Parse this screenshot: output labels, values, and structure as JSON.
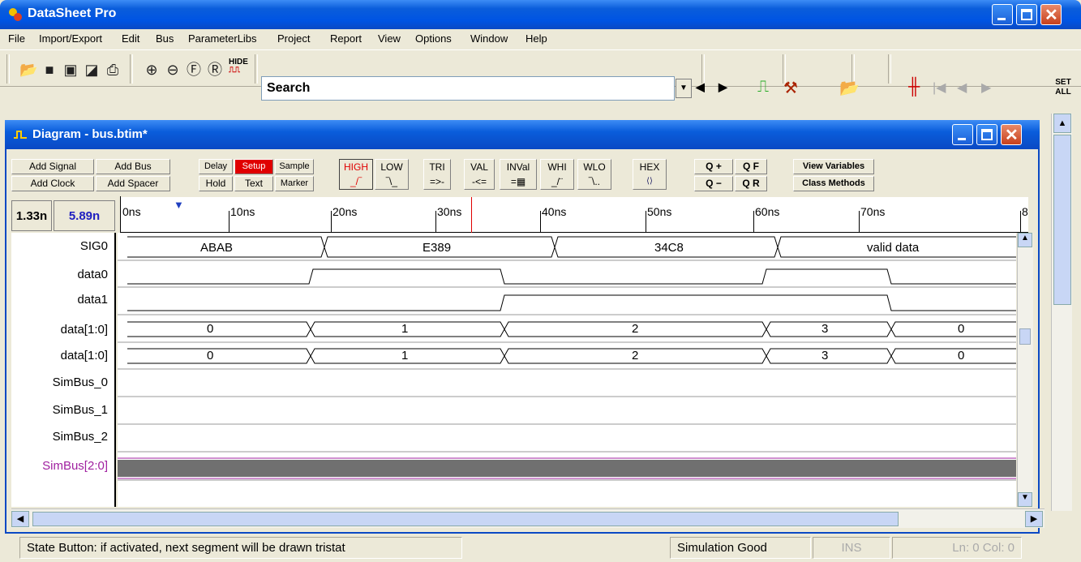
{
  "app": {
    "title": "DataSheet Pro"
  },
  "menu": [
    "File",
    "Import/Export",
    "Edit",
    "Bus",
    "ParameterLibs",
    "Project",
    "Report",
    "View",
    "Options",
    "Window",
    "Help"
  ],
  "toolbar": {
    "search_value": "Search",
    "hide_label": "HIDE",
    "set_all_label": "SET ALL"
  },
  "diagram": {
    "title": "Diagram - bus.btim*",
    "buttons": {
      "add_signal": "Add Signal",
      "add_bus": "Add Bus",
      "add_clock": "Add Clock",
      "add_spacer": "Add Spacer",
      "delay": "Delay",
      "setup": "Setup",
      "sample": "Sample",
      "hold": "Hold",
      "text": "Text",
      "marker": "Marker",
      "high": "HIGH",
      "low": "LOW",
      "tri": "TRI",
      "val": "VAL",
      "inval": "INVal",
      "whi": "WHI",
      "wlo": "WLO",
      "hex": "HEX",
      "zoom_in": "Q +",
      "zoom_fit": "Q F",
      "zoom_out": "Q −",
      "zoom_reset": "Q R",
      "view_variables": "View Variables",
      "class_methods": "Class Methods"
    },
    "time_left": "1.33n",
    "time_right": "5.89n",
    "ruler": [
      "0ns",
      "10ns",
      "20ns",
      "30ns",
      "40ns",
      "50ns",
      "60ns",
      "70ns",
      "8"
    ],
    "signals": [
      {
        "name": "SIG0",
        "segments": [
          "ABAB",
          "E389",
          "34C8",
          "valid data"
        ]
      },
      {
        "name": "data0"
      },
      {
        "name": "data1"
      },
      {
        "name": "data[1:0]",
        "segments": [
          "0",
          "1",
          "2",
          "3",
          "0"
        ]
      },
      {
        "name": "data[1:0]",
        "segments": [
          "0",
          "1",
          "2",
          "3",
          "0"
        ]
      },
      {
        "name": "SimBus_0"
      },
      {
        "name": "SimBus_1"
      },
      {
        "name": "SimBus_2"
      },
      {
        "name": "SimBus[2:0]"
      }
    ]
  },
  "status": {
    "message": "State Button: if activated, next segment will be drawn tristat",
    "sim": "Simulation Good",
    "ins": "INS",
    "pos": "Ln: 0  Col: 0"
  },
  "colors": {
    "title_blue": "#0054e3",
    "simbus_purple": "#a020a0",
    "setup_red": "#e00000"
  }
}
